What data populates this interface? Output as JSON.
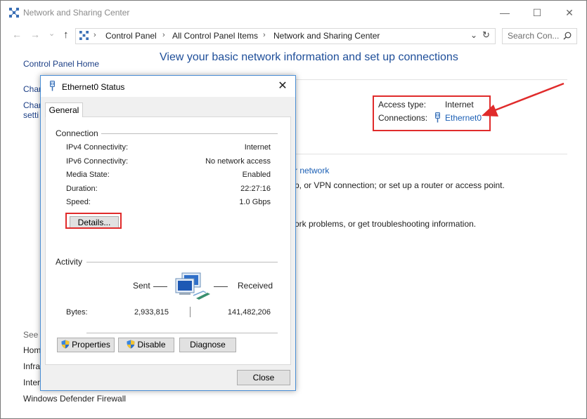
{
  "window": {
    "title": "Network and Sharing Center",
    "minimize_glyph": "—",
    "maximize_glyph": "☐",
    "close_glyph": "✕"
  },
  "address_bar": {
    "back_glyph": "←",
    "forward_glyph": "→",
    "recent_glyph": "⌄",
    "up_glyph": "↑",
    "breadcrumbs": [
      "Control Panel",
      "All Control Panel Items",
      "Network and Sharing Center"
    ],
    "separator": "›",
    "dropdown_glyph": "⌄",
    "refresh_glyph": "↻"
  },
  "search": {
    "placeholder": "Search Con...",
    "icon": "search-icon"
  },
  "sidebar": {
    "home": "Control Panel Home",
    "items": [
      "Char",
      "Char",
      "setti"
    ],
    "see_also": "See a",
    "see_also_items": [
      "Hom",
      "Infra",
      "Inter",
      "Windows Defender Firewall"
    ]
  },
  "main": {
    "heading": "View your basic network information and set up connections",
    "access_type_label": "Access type:",
    "access_type_value": "Internet",
    "connections_label": "Connections:",
    "connections_value": "Ethernet0",
    "new_network_link": "r network",
    "setup_text": "p, or VPN connection; or set up a router or access point.",
    "troubleshoot_text": "ork problems, or get troubleshooting information."
  },
  "dialog": {
    "title": "Ethernet0 Status",
    "close_glyph": "✕",
    "tab": "General",
    "connection_group": "Connection",
    "rows": [
      {
        "label": "IPv4 Connectivity:",
        "value": "Internet"
      },
      {
        "label": "IPv6 Connectivity:",
        "value": "No network access"
      },
      {
        "label": "Media State:",
        "value": "Enabled"
      },
      {
        "label": "Duration:",
        "value": "22:27:16"
      },
      {
        "label": "Speed:",
        "value": "1.0 Gbps"
      }
    ],
    "details_button": "Details...",
    "activity_group": "Activity",
    "sent_label": "Sent",
    "received_label": "Received",
    "bytes_label": "Bytes:",
    "bytes_sent": "2,933,815",
    "bytes_received": "141,482,206",
    "properties_button": "Properties",
    "disable_button": "Disable",
    "diagnose_button": "Diagnose",
    "close_button": "Close"
  },
  "colors": {
    "highlight": "#e02b2b",
    "link": "#1b5fb5",
    "heading": "#1e4e99"
  }
}
